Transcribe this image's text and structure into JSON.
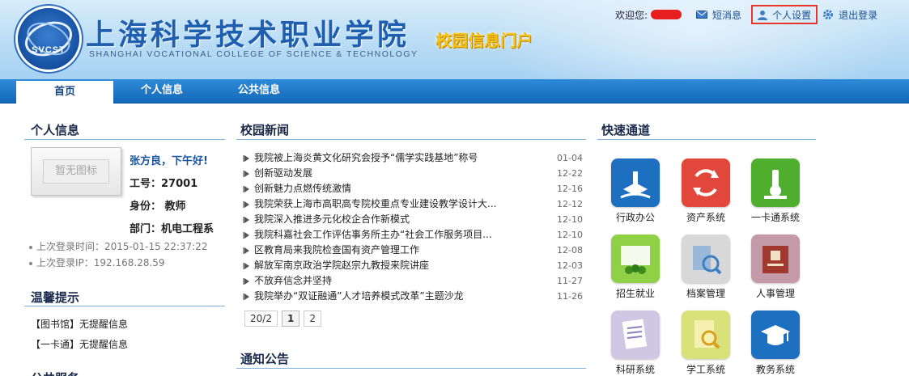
{
  "header": {
    "school_cn": "上海科学技术职业学院",
    "school_en": "SHANGHAI VOCATIONAL COLLEGE OF SCIENCE & TECHNOLOGY",
    "logo_text": "SVCST",
    "portal_title": "校园信息门户",
    "welcome": "欢迎您:",
    "messages": "短消息",
    "settings": "个人设置",
    "logout": "退出登录"
  },
  "nav": {
    "items": [
      {
        "label": "首页",
        "active": true
      },
      {
        "label": "个人信息",
        "active": false
      },
      {
        "label": "公共信息",
        "active": false
      }
    ]
  },
  "profile": {
    "title": "个人信息",
    "avatar_placeholder": "暂无图标",
    "greeting": "张方良，下午好!",
    "employee_no": "工号：27001",
    "identity": "身份：  教师",
    "department": "部门：机电工程系",
    "last_login_time": "上次登录时间：2015-01-15 22:37:22",
    "last_login_ip": "上次登录IP：192.168.28.59"
  },
  "tips": {
    "title": "温馨提示",
    "items": [
      "【图书馆】无提醒信息",
      "【一卡通】无提醒信息"
    ],
    "next_title": "公共服务"
  },
  "news": {
    "title": "校园新闻",
    "items": [
      {
        "title": "我院被上海炎黄文化研究会授予“儒学实践基地”称号",
        "date": "01-04"
      },
      {
        "title": "创新驱动发展",
        "date": "12-22"
      },
      {
        "title": "创新魅力点燃传统激情",
        "date": "12-16"
      },
      {
        "title": "我院荣获上海市高职高专院校重点专业建设教学设计大...",
        "date": "12-12"
      },
      {
        "title": "我院深入推进多元化校企合作新模式",
        "date": "12-10"
      },
      {
        "title": "我院科嘉社会工作评估事务所主办“社会工作服务项目...",
        "date": "12-10"
      },
      {
        "title": "区教育局来我院检查国有资产管理工作",
        "date": "12-08"
      },
      {
        "title": "解放军南京政治学院赵宗九教授来院讲座",
        "date": "12-03"
      },
      {
        "title": "不放弃信念并坚持",
        "date": "11-27"
      },
      {
        "title": "我院举办“双证融通”人才培养模式改革”主题沙龙",
        "date": "11-26"
      }
    ],
    "pager": {
      "summary": "20/2",
      "pages": [
        "1",
        "2"
      ],
      "current": "1"
    }
  },
  "notice": {
    "title": "通知公告"
  },
  "quick": {
    "title": "快速通道",
    "items": [
      {
        "label": "行政办公",
        "icon": "admin-office-icon",
        "color": "#1d6fc0"
      },
      {
        "label": "资产系统",
        "icon": "asset-system-icon",
        "color": "#e2473b"
      },
      {
        "label": "一卡通系统",
        "icon": "card-system-icon",
        "color": "#4fae2e"
      },
      {
        "label": "招生就业",
        "icon": "enrollment-icon",
        "color": "#8fd046"
      },
      {
        "label": "档案管理",
        "icon": "archive-icon",
        "color": "#d8d8d8"
      },
      {
        "label": "人事管理",
        "icon": "personnel-icon",
        "color": "#c49aa8"
      },
      {
        "label": "科研系统",
        "icon": "research-icon",
        "color": "#cfc7e4"
      },
      {
        "label": "学工系统",
        "icon": "student-affairs-icon",
        "color": "#d9e27a"
      },
      {
        "label": "教务系统",
        "icon": "academic-affairs-icon",
        "color": "#1d6fc0"
      }
    ]
  }
}
